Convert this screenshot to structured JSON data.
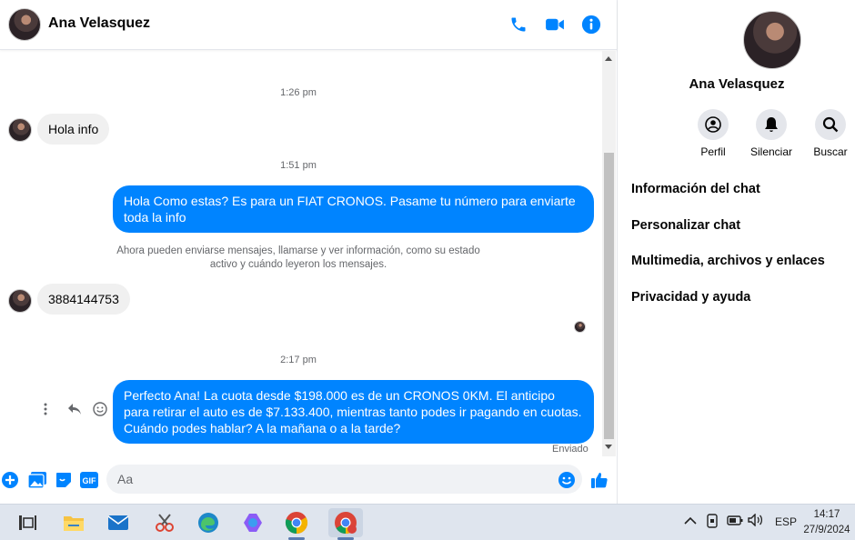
{
  "contact": {
    "name": "Ana Velasquez"
  },
  "header_icons": [
    "phone-icon",
    "video-camera-icon",
    "info-icon"
  ],
  "messages": [
    {
      "time": "1:26 pm"
    },
    {
      "incoming": "Hola info"
    },
    {
      "time": "1:51 pm"
    },
    {
      "outgoing": "Hola Como estas?  Es para un FIAT CRONOS. Pasame tu número para enviarte toda la info"
    },
    {
      "system": "Ahora pueden enviarse mensajes, llamarse y ver información, como su estado activo y cuándo leyeron los mensajes."
    },
    {
      "incoming": "3884144753"
    },
    {
      "time": "2:17 pm"
    },
    {
      "outgoing": "Perfecto Ana!  La cuota desde $198.000 es de un CRONOS 0KM. El anticipo para retirar el auto es de $7.133.400, mientras tanto podes ir pagando en cuotas. Cuándo podes hablar? A la mañana o a la tarde?"
    },
    {
      "status": "Enviado"
    }
  ],
  "composer": {
    "placeholder": "Aa"
  },
  "info_panel": {
    "name": "Ana Velasquez",
    "actions": [
      {
        "label": "Perfil",
        "icon": "profile-icon"
      },
      {
        "label": "Silenciar",
        "icon": "bell-icon"
      },
      {
        "label": "Buscar",
        "icon": "search-icon"
      }
    ],
    "menu": [
      "Información del chat",
      "Personalizar chat",
      "Multimedia, archivos y enlaces",
      "Privacidad y ayuda"
    ]
  },
  "taskbar": {
    "language": "ESP",
    "time": "14:17",
    "date": "27/9/2024"
  },
  "colors": {
    "accent": "#0084ff",
    "incoming_bubble": "#f0f0f0"
  }
}
